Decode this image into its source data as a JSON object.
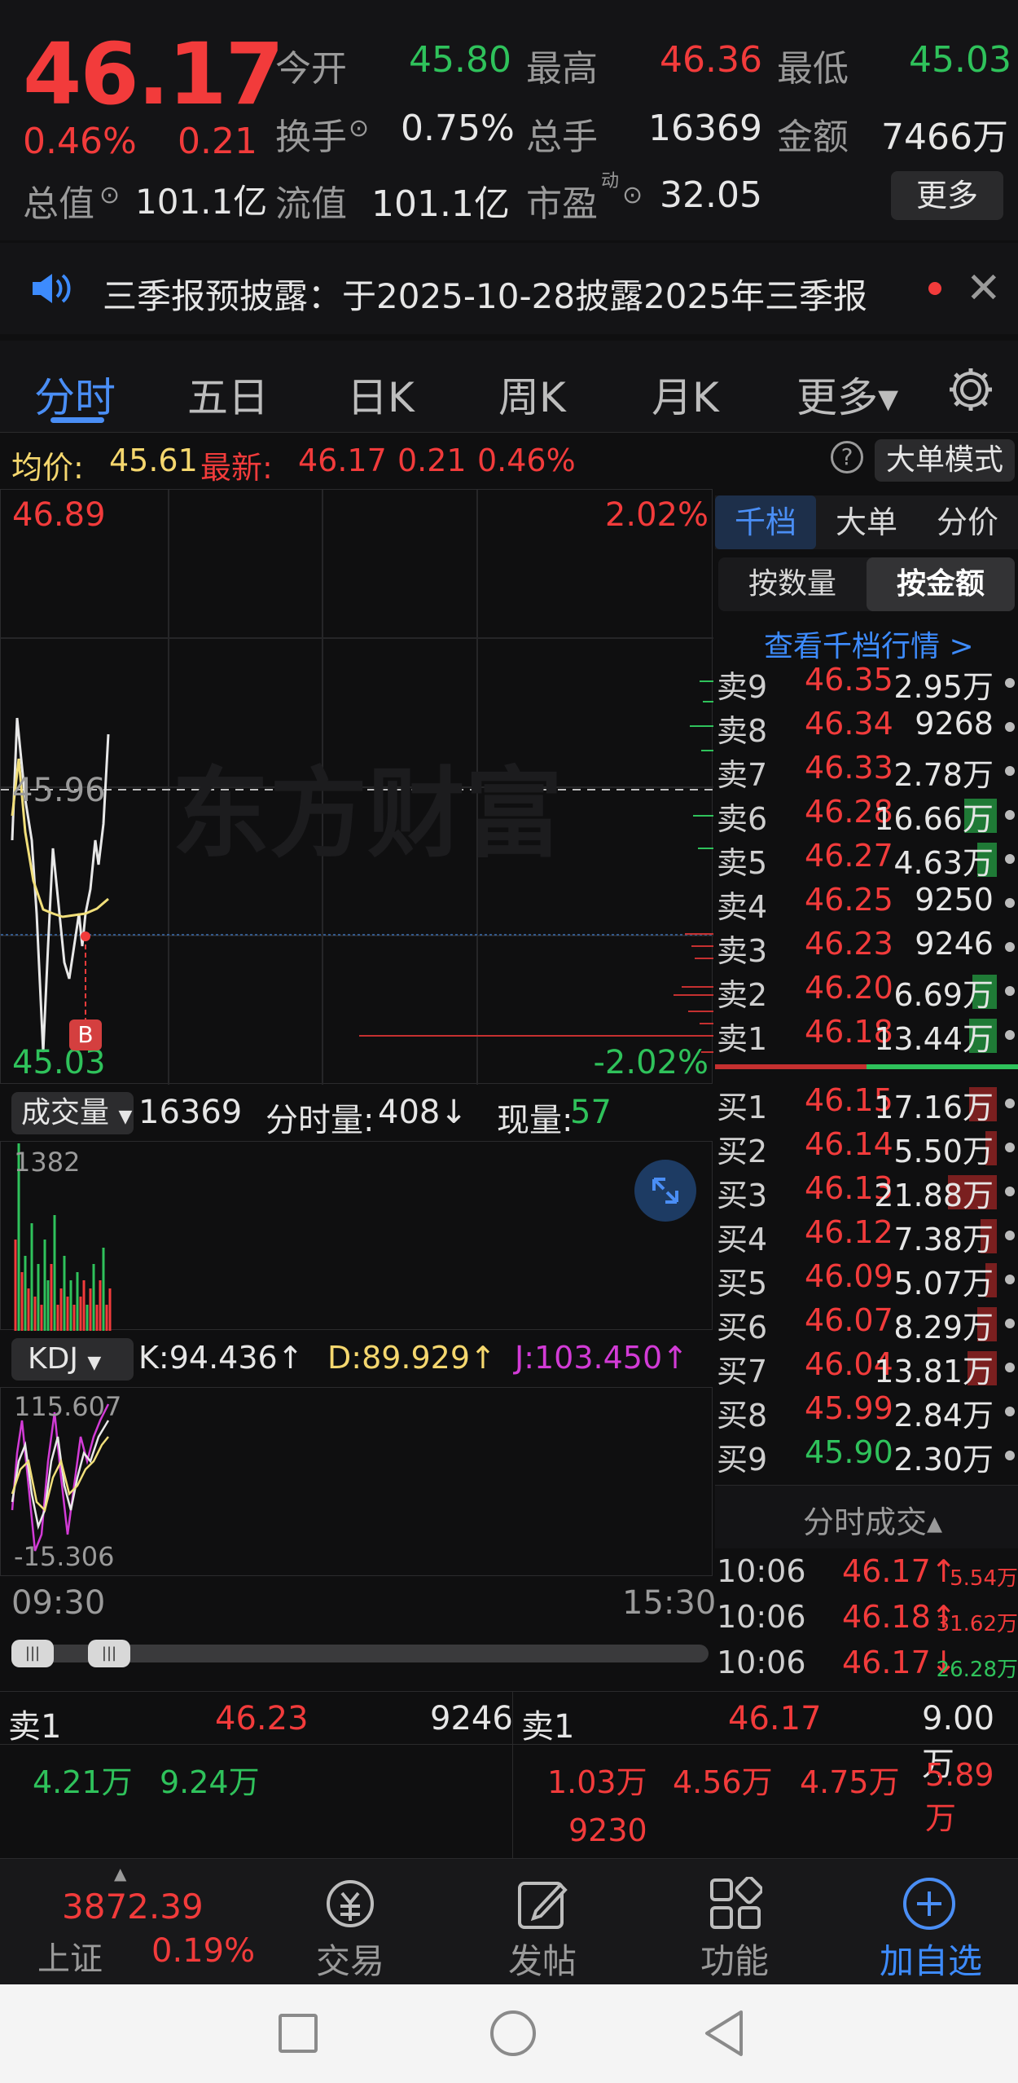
{
  "header": {
    "price": "46.17",
    "change_pct": "0.46%",
    "change": "0.21",
    "open_label": "今开",
    "open_value": "45.80",
    "high_label": "最高",
    "high_value": "46.36",
    "low_label": "最低",
    "low_value": "45.03",
    "turnover_label": "换手",
    "turnover_value": "0.75%",
    "volume_label": "总手",
    "volume_value": "16369",
    "amount_label": "金额",
    "amount_value": "7466万",
    "mktcap_label": "总值",
    "mktcap_value": "101.1亿",
    "float_label": "流值",
    "float_value": "101.1亿",
    "pe_label": "市盈",
    "pe_sup": "动",
    "pe_value": "32.05",
    "more_button": "更多"
  },
  "notice": {
    "text": "三季报预披露：于2025-10-28披露2025年三季报",
    "speaker_icon": "speaker-icon",
    "close_icon": "close-icon"
  },
  "tabs": [
    "分时",
    "五日",
    "日K",
    "周K",
    "月K",
    "更多▾"
  ],
  "tabs_active": 0,
  "info_line": {
    "avg_label": "均价:",
    "avg_value": "45.61",
    "latest_label": "最新:",
    "latest_value": "46.17",
    "change": "0.21",
    "change_pct": "0.46%",
    "big_order_mode": "大单模式"
  },
  "chart": {
    "top_price": "46.89",
    "top_pct": "2.02%",
    "bottom_price": "45.03",
    "bottom_pct": "-2.02%",
    "mid_price": "45.96",
    "watermark": "东方财富",
    "b_marker": "B"
  },
  "volume_panel": {
    "label": "成交量",
    "value": "16369",
    "tick_vol_label": "分时量:",
    "tick_vol_value": "408↓",
    "cur_label": "现量:",
    "cur_value": "57",
    "max_tick": "1382"
  },
  "kdj_panel": {
    "label": "KDJ",
    "k": "K:94.436↑",
    "d": "D:89.929↑",
    "j": "J:103.450↑",
    "max_tick": "115.607",
    "min_tick": "-15.306"
  },
  "time_axis": {
    "start": "09:30",
    "end": "15:30"
  },
  "orderbook": {
    "tabs": [
      "千档",
      "大单",
      "分价"
    ],
    "toggle": [
      "按数量",
      "按金额"
    ],
    "link": "查看千档行情 >",
    "asks": [
      {
        "label": "卖9",
        "price": "46.35",
        "vol": "2.95万"
      },
      {
        "label": "卖8",
        "price": "46.34",
        "vol": "9268"
      },
      {
        "label": "卖7",
        "price": "46.33",
        "vol": "2.78万"
      },
      {
        "label": "卖6",
        "price": "46.28",
        "vol": "16.66万"
      },
      {
        "label": "卖5",
        "price": "46.27",
        "vol": "4.63万"
      },
      {
        "label": "卖4",
        "price": "46.25",
        "vol": "9250"
      },
      {
        "label": "卖3",
        "price": "46.23",
        "vol": "9246"
      },
      {
        "label": "卖2",
        "price": "46.20",
        "vol": "6.69万"
      },
      {
        "label": "卖1",
        "price": "46.18",
        "vol": "13.44万"
      }
    ],
    "bids": [
      {
        "label": "买1",
        "price": "46.15",
        "vol": "17.16万"
      },
      {
        "label": "买2",
        "price": "46.14",
        "vol": "5.50万"
      },
      {
        "label": "买3",
        "price": "46.13",
        "vol": "21.88万"
      },
      {
        "label": "买4",
        "price": "46.12",
        "vol": "7.38万"
      },
      {
        "label": "买5",
        "price": "46.09",
        "vol": "5.07万"
      },
      {
        "label": "买6",
        "price": "46.07",
        "vol": "8.29万"
      },
      {
        "label": "买7",
        "price": "46.04",
        "vol": "13.81万"
      },
      {
        "label": "买8",
        "price": "45.99",
        "vol": "2.84万"
      },
      {
        "label": "买9",
        "price": "45.90",
        "vol": "2.30万"
      }
    ],
    "ticks_title": "分时成交▴",
    "ticks": [
      {
        "time": "10:06",
        "price": "46.17↑",
        "vol": "5.54万"
      },
      {
        "time": "10:06",
        "price": "46.18↑",
        "vol": "31.62万"
      },
      {
        "time": "10:06",
        "price": "46.17↓",
        "vol": "26.28万"
      }
    ]
  },
  "bottom_quote": {
    "left_label": "卖1",
    "left_price": "46.23",
    "left_vol": "9246",
    "left_items": [
      "4.21万",
      "9.24万"
    ],
    "right_label": "卖1",
    "right_price": "46.17",
    "right_vol": "9.00万",
    "right_items": [
      "1.03万",
      "4.56万",
      "4.75万",
      "5.89万"
    ],
    "right_extra": "9230"
  },
  "nav": {
    "index_value": "3872.39",
    "index_name": "上证",
    "index_pct": "0.19%",
    "trade": "交易",
    "post": "发帖",
    "func": "功能",
    "add": "加自选"
  }
}
